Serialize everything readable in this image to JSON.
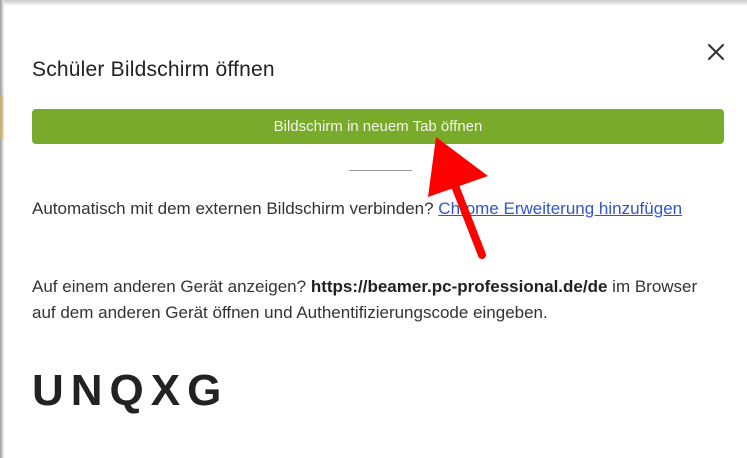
{
  "dialog": {
    "title": "Schüler Bildschirm öffnen",
    "close_icon": "close-icon",
    "open_tab_button": "Bildschirm in neuem Tab öffnen",
    "extension_prompt": "Automatisch mit dem externen Bildschirm verbinden? ",
    "extension_link": "Chrome Erweiterung hinzufügen",
    "other_device_prompt": "Auf einem anderen Gerät anzeigen? ",
    "other_device_url": "https://beamer.pc-professional.de/de",
    "other_device_instructions": " im Browser auf dem anderen Gerät öffnen und Authentifizierungscode eingeben.",
    "auth_code": "UNQXG"
  },
  "annotation": {
    "arrow_icon": "red-arrow-icon",
    "arrow_color": "#ff0000"
  },
  "colors": {
    "primary_button": "#7aaa2c",
    "link": "#3355cc"
  }
}
